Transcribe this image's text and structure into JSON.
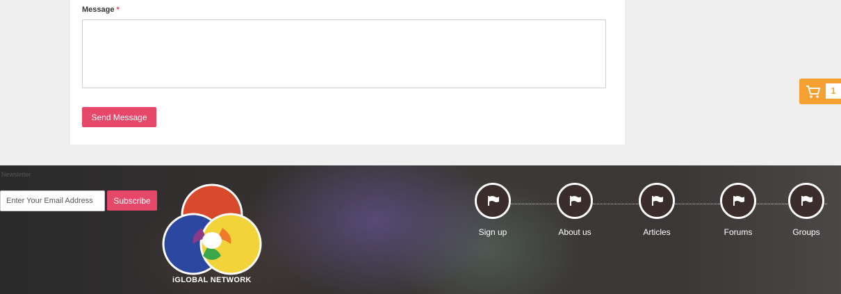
{
  "form": {
    "message_label": "Message",
    "required_mark": "*",
    "message_value": "",
    "send_label": "Send Message"
  },
  "cart": {
    "icon": "cart-icon",
    "count": "1",
    "color": "#f5a030"
  },
  "footer": {
    "newsletter_label": "Newsletter",
    "email_placeholder": "Enter Your Email Address",
    "subscribe_label": "Subscribe",
    "logo_text": "iGLOBAL NETWORK",
    "nav": [
      {
        "label": "Sign up",
        "icon": "flag-icon"
      },
      {
        "label": "About us",
        "icon": "flag-icon"
      },
      {
        "label": "Articles",
        "icon": "flag-icon"
      },
      {
        "label": "Forums",
        "icon": "flag-icon"
      },
      {
        "label": "Groups",
        "icon": "flag-icon"
      }
    ]
  },
  "colors": {
    "accent": "#e6486a",
    "logo_red": "#d84a2b",
    "logo_blue": "#2c47a0",
    "logo_yellow": "#f2d33a",
    "logo_purple": "#8a3a8a",
    "logo_orange": "#f07a2a",
    "logo_green": "#3aa84a"
  }
}
